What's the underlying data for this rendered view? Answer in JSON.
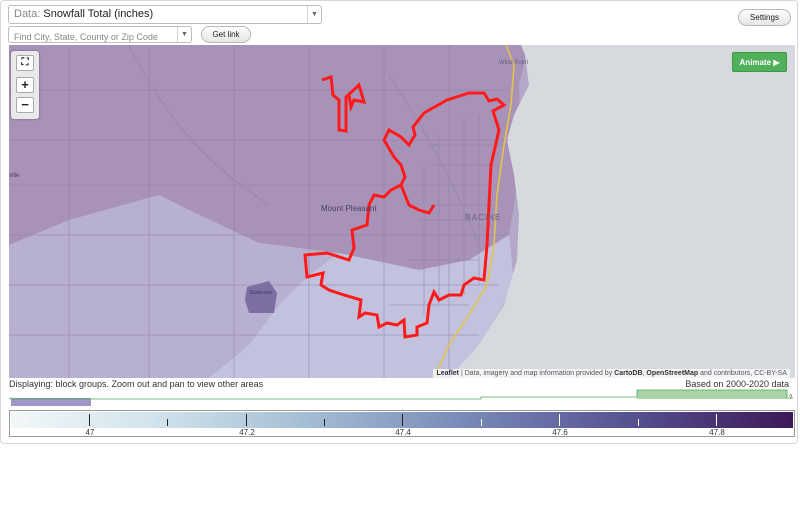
{
  "controls": {
    "data_prefix": "Data:",
    "data_selected": "Snowfall Total (inches)",
    "search_placeholder": "Find City, State, County or Zip Code",
    "get_link_label": "Get link",
    "settings_label": "Settings",
    "zoom_in": "+",
    "zoom_out": "−",
    "animate_label": "Animate ▶"
  },
  "map": {
    "labels": {
      "wind_point": "Wind Point",
      "mount_pleasant": "Mount Pleasant",
      "racine": "RACINE",
      "sturtevant": "Sturtevant",
      "ville": "ville"
    },
    "attribution": {
      "leaflet": "Leaflet",
      "middle": " | Data, imagery and map information provided by ",
      "cartodb": "CartoDB",
      "comma": ", ",
      "osm": "OpenStreetMap",
      "tail": " and contributors, CC-BY-SA"
    },
    "colors": {
      "boundary": "#ff1a1a",
      "highway": "#e2c44a",
      "lake": "#d6dadf",
      "north_fill": "#aa93b8",
      "south_fill": "#c3c3dd"
    }
  },
  "footer": {
    "status": "Displaying: block groups. Zoom out and pan to view other areas",
    "based_on": "Based on 2000-2020 data",
    "histogram_edge_label": "?"
  },
  "legend": {
    "tick_labels": [
      "47",
      "47.2",
      "47.4",
      "47.6",
      "47.8"
    ],
    "min": 46.9,
    "max": 47.9,
    "gradient": [
      "#f3f7f8",
      "#d2e4ec",
      "#a7bfd5",
      "#7d8fba",
      "#5b5a98",
      "#3d1857"
    ]
  }
}
